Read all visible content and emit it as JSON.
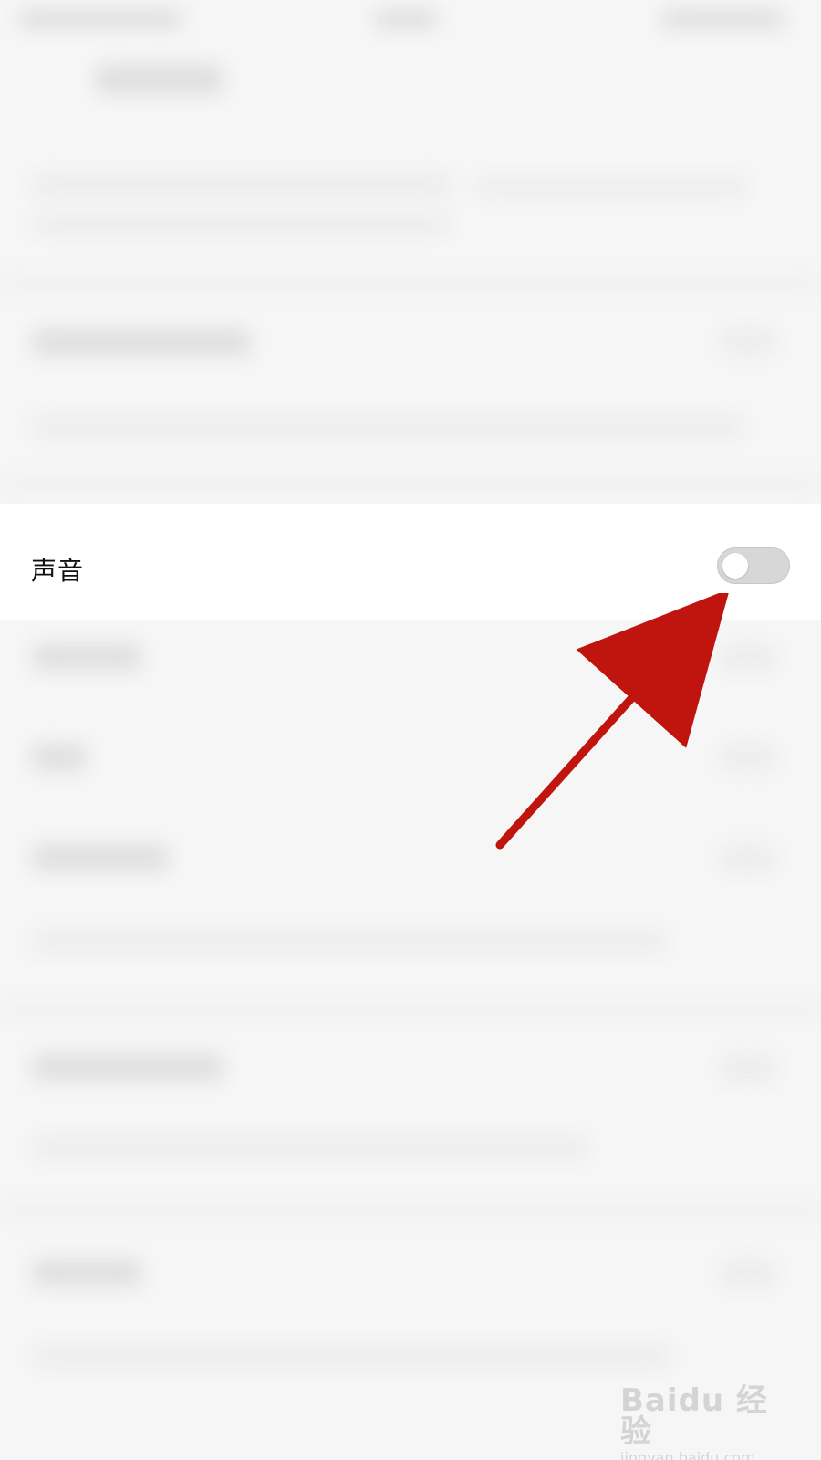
{
  "settings": {
    "sound": {
      "label": "声音",
      "enabled": false
    }
  },
  "annotation": {
    "arrow_color": "#C0140E"
  },
  "watermark": {
    "logo": "Baidu 经验",
    "url": "jingyan.baidu.com"
  }
}
